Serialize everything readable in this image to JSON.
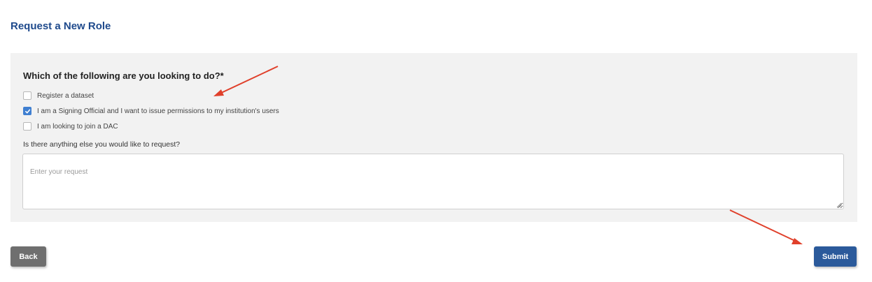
{
  "page": {
    "title": "Request a New Role"
  },
  "form": {
    "question": "Which of the following are you looking to do?*",
    "options": [
      {
        "label": "Register a dataset",
        "checked": false
      },
      {
        "label": "I am a Signing Official and I want to issue permissions to my institution's users",
        "checked": true
      },
      {
        "label": "I am looking to join a DAC",
        "checked": false
      }
    ],
    "extra_label": "Is there anything else you would like to request?",
    "request_placeholder": "Enter your request",
    "request_value": ""
  },
  "buttons": {
    "back_label": "Back",
    "submit_label": "Submit"
  },
  "colors": {
    "title": "#1f4a8c",
    "panel_bg": "#f2f2f2",
    "checkbox_checked": "#3f7fd1",
    "back_button": "#6f6f6f",
    "submit_button": "#2b5a9b",
    "annotation_arrow": "#e0402b"
  },
  "icons": {
    "checkmark": "check-icon",
    "annotation": "red-arrow-icon"
  }
}
